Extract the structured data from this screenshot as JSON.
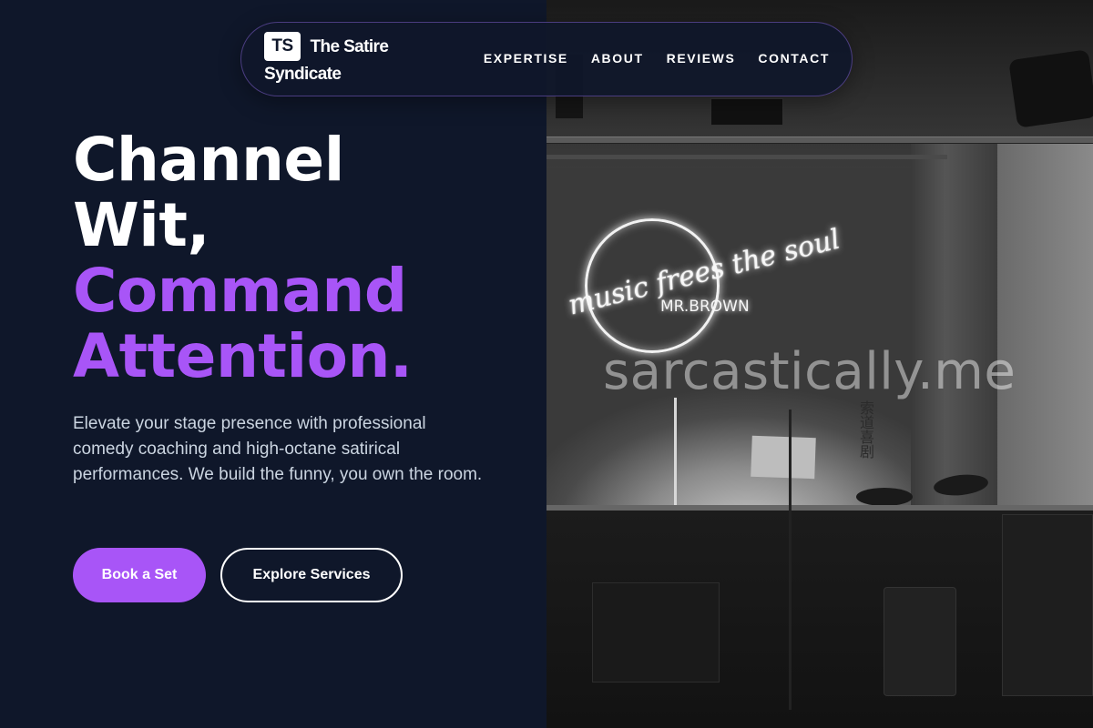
{
  "brand": {
    "mark": "TS",
    "name_line1": "The Satire",
    "name_line2": "Syndicate"
  },
  "nav": {
    "links": [
      "EXPERTISE",
      "ABOUT",
      "REVIEWS",
      "CONTACT"
    ]
  },
  "hero": {
    "title_line1": "Channel",
    "title_line2": "Wit,",
    "title_line3": "Command",
    "title_line4": "Attention.",
    "description": "Elevate your stage presence with professional comedy coaching and high-octane satirical performances. We build the funny, you own the room.",
    "primary_button": "Book a Set",
    "secondary_button": "Explore Services"
  },
  "photo": {
    "neon_script": "music frees the soul",
    "neon_sub": "MR.BROWN",
    "banner_text": "索道喜剧",
    "watermark": "sarcastically.me"
  },
  "colors": {
    "background": "#0f172a",
    "accent": "#a855f7",
    "text": "#ffffff",
    "muted_text": "#cbd5e1"
  }
}
